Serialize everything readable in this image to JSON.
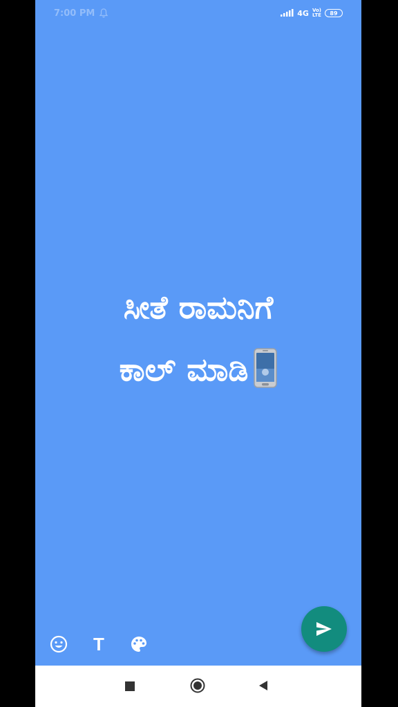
{
  "statusbar": {
    "time": "7:00 PM",
    "network": "4G",
    "volte_top": "Vo)",
    "volte_bottom": "LTE",
    "battery": "89"
  },
  "status_post": {
    "line1": "ಸೀತೆ ರಾಮನಿಗೆ",
    "line2": "ಕಾಲ್ ಮಾಡಿ",
    "emoji": "mobile-phone-icon"
  },
  "tools": [
    "emoji-icon",
    "text-tool",
    "palette-icon"
  ],
  "tool_text_label": "T",
  "colors": {
    "background": "#5a9af7",
    "send_button": "#128c7e"
  }
}
